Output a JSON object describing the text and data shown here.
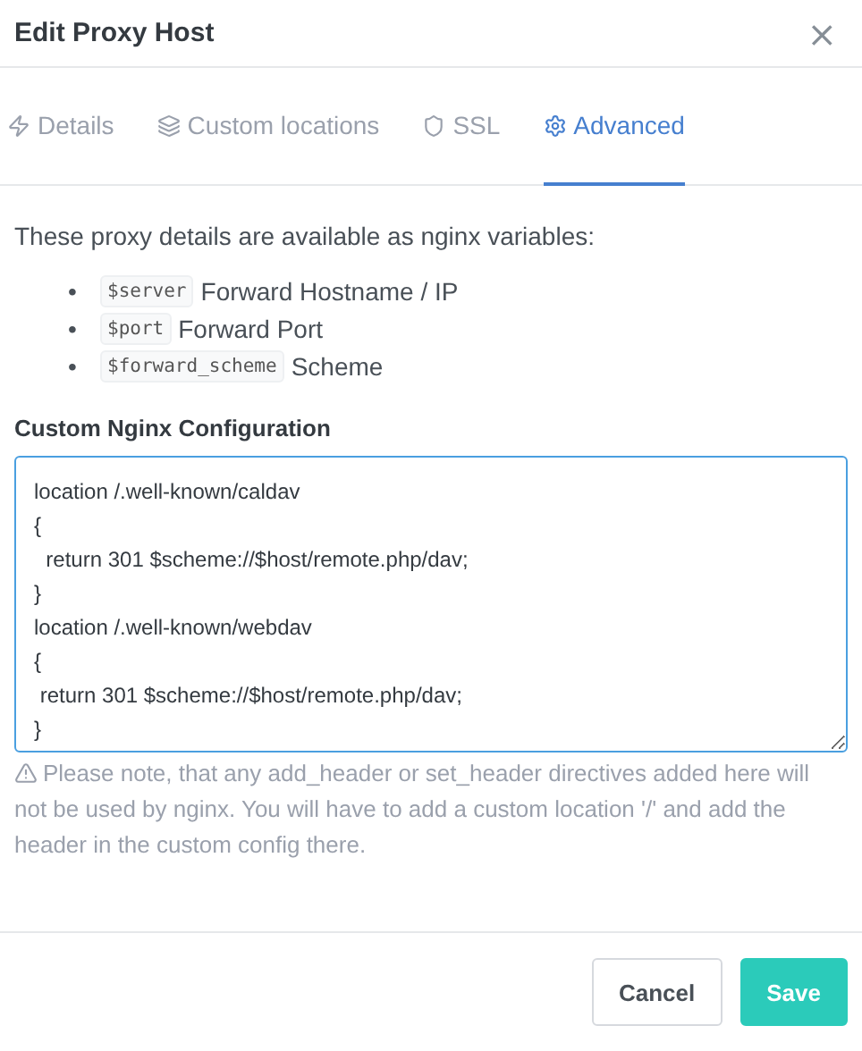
{
  "dialog": {
    "title": "Edit Proxy Host",
    "close": "×"
  },
  "tabs": [
    {
      "label": "Details",
      "selected": false
    },
    {
      "label": "Custom locations",
      "selected": false
    },
    {
      "label": "SSL",
      "selected": false
    },
    {
      "label": "Advanced",
      "selected": true
    }
  ],
  "intro": "These proxy details are available as nginx variables:",
  "variables": [
    {
      "bullet": "•",
      "code": "$server",
      "description": "Forward Hostname / IP"
    },
    {
      "bullet": "•",
      "code": "$port",
      "description": "Forward Port"
    },
    {
      "bullet": "•",
      "code": "$forward_scheme",
      "description": "Scheme"
    }
  ],
  "config": {
    "label": "Custom Nginx Configuration",
    "lines": [
      "location /.well-known/caldav",
      "{",
      "  return 301 $scheme://$host/remote.php/dav;",
      "}",
      "location /.well-known/webdav",
      "{",
      " return 301 $scheme://$host/remote.php/dav;",
      "}"
    ],
    "note": "Please note, that any add_header or set_header directives added here will not be used by nginx. You will have to add a custom location '/' and add the header in the custom config there."
  },
  "buttons": [
    {
      "label": "Cancel",
      "kind": "secondary"
    },
    {
      "label": "Save",
      "kind": "primary"
    }
  ]
}
